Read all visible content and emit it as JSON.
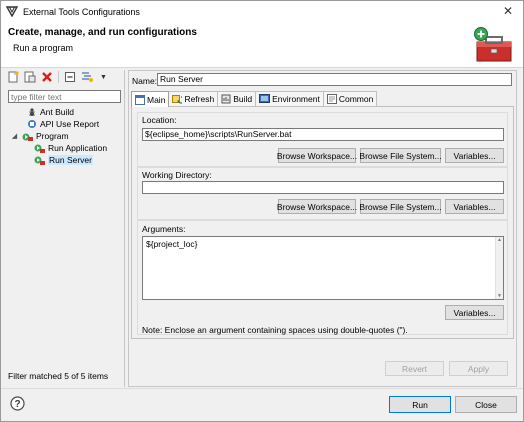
{
  "window": {
    "title": "External Tools Configurations"
  },
  "header": {
    "title": "Create, manage, and run configurations",
    "subtitle": "Run a program"
  },
  "sidebar": {
    "filter_placeholder": "type filter text",
    "tree": [
      {
        "label": "Ant Build",
        "level": 1,
        "icon": "ant-icon"
      },
      {
        "label": "API Use Report",
        "level": 1,
        "icon": "api-report-icon"
      },
      {
        "label": "Program",
        "level": 0,
        "icon": "program-icon",
        "expanded": true
      },
      {
        "label": "Run Application",
        "level": 1,
        "icon": "run-program-icon"
      },
      {
        "label": "Run Server",
        "level": 1,
        "icon": "run-program-icon",
        "selected": true
      }
    ],
    "status": "Filter matched 5 of 5 items"
  },
  "editor": {
    "name_label": "Name:",
    "name_value": "Run Server",
    "tabs": [
      "Main",
      "Refresh",
      "Build",
      "Environment",
      "Common"
    ],
    "active_tab": "Main",
    "location": {
      "label": "Location:",
      "value": "${eclipse_home}\\scripts\\RunServer.bat",
      "buttons": [
        "Browse Workspace...",
        "Browse File System...",
        "Variables..."
      ]
    },
    "working_dir": {
      "label": "Working Directory:",
      "value": "",
      "buttons": [
        "Browse Workspace...",
        "Browse File System...",
        "Variables..."
      ]
    },
    "arguments": {
      "label": "Arguments:",
      "value": "${project_loc}",
      "variables_button": "Variables...",
      "note": "Note: Enclose an argument containing spaces using double-quotes (\")."
    },
    "revert_label": "Revert",
    "apply_label": "Apply"
  },
  "footer": {
    "run_label": "Run",
    "close_label": "Close"
  },
  "colors": {
    "selection": "#cce8ff",
    "accent": "#0078d7",
    "toolbox_red": "#c9302c",
    "add_green": "#3aa655"
  }
}
